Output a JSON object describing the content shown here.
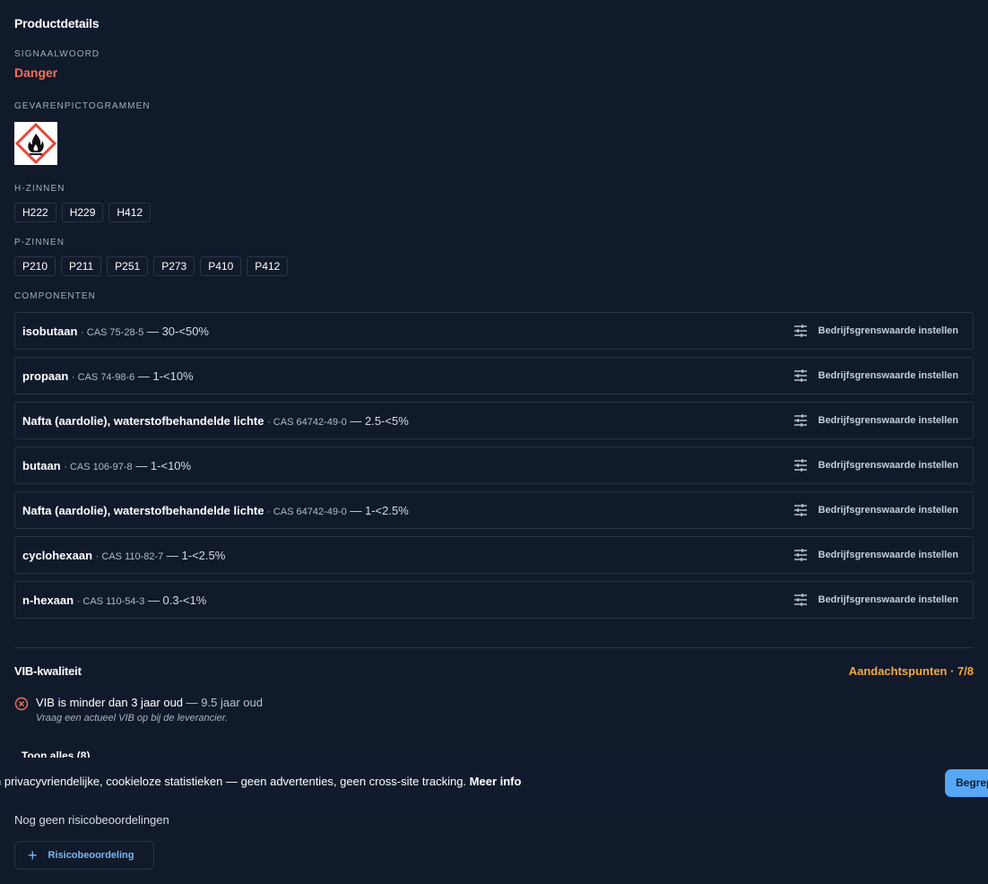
{
  "product": {
    "title": "Productdetails",
    "signal_label": "SIGNAALWOORD",
    "signal_word": "Danger",
    "pictograms_label": "GEVARENPICTOGRAMMEN",
    "pictograms": [
      "flame-pictogram"
    ],
    "h_label": "H-ZINNEN",
    "h_phrases": [
      "H222",
      "H229",
      "H412"
    ],
    "p_label": "P-ZINNEN",
    "p_phrases": [
      "P210",
      "P211",
      "P251",
      "P273",
      "P410",
      "P412"
    ]
  },
  "components": {
    "label": "COMPONENTEN",
    "action_label": "Bedrijfsgrenswaarde instellen",
    "items": [
      {
        "name": "isobutaan",
        "cas": "· CAS 75-28-5",
        "conc": "— 30-<50%"
      },
      {
        "name": "propaan",
        "cas": "· CAS 74-98-6",
        "conc": "— 1-<10%"
      },
      {
        "name": "Nafta (aardolie), waterstofbehandelde lichte",
        "cas": "· CAS 64742-49-0",
        "conc": "— 2.5-<5%"
      },
      {
        "name": "butaan",
        "cas": "· CAS 106-97-8",
        "conc": "— 1-<10%"
      },
      {
        "name": "Nafta (aardolie), waterstofbehandelde lichte",
        "cas": "· CAS 64742-49-0",
        "conc": "— 1-<2.5%"
      },
      {
        "name": "cyclohexaan",
        "cas": "· CAS 110-82-7",
        "conc": "— 1-<2.5%"
      },
      {
        "name": "n-hexaan",
        "cas": "· CAS 110-54-3",
        "conc": "— 0.3-<1%"
      }
    ]
  },
  "vib": {
    "title": "VIB-kwaliteit",
    "status": "Aandachtspunten · 7/8",
    "item_main": "VIB is minder dan 3 jaar oud",
    "item_detail": "— 9.5 jaar oud",
    "item_sub": "Vraag een actueel VIB op bij de leverancier.",
    "show_all": "Toon alles (8)"
  },
  "cookie": {
    "text": "n privacyvriendelijke, cookieloze statistieken — geen advertenties, geen cross-site tracking.",
    "link": "Meer info",
    "button": "Begrepen"
  },
  "risk": {
    "empty_text": "Nog geen risicobeoordelingen",
    "add_button": "Risicobeoordeling"
  },
  "colors": {
    "background": "#111a2b",
    "danger": "#f0725f",
    "warning": "#f3a93a",
    "accent": "#57a7f5"
  }
}
